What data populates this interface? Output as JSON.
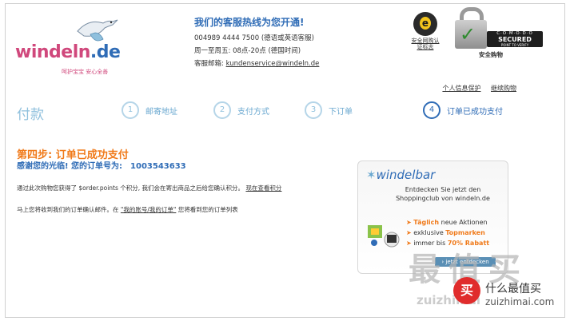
{
  "logo": {
    "wordmark_left": "windeln",
    "wordmark_right": ".de",
    "tagline": "呵护宝宝 安心全善"
  },
  "contact": {
    "title": "我们的客服热线为您开通!",
    "phone": "004989 4444 7500 (德语或英语客服)",
    "hours": "周一至周五: 08点-20点 (德国时间)",
    "email_label": "客服邮箱:",
    "email": "kundenservice@windeln.de"
  },
  "trust": {
    "badge1_label": "安全网购认证标志",
    "comodo_line1": "C·O·M·O·D·O",
    "comodo_line2": "SECURED",
    "comodo_line3": "POINT TO VERIFY",
    "badge2_label": "安全购物"
  },
  "toplinks": {
    "privacy": "个人信息保护",
    "continue": "继续购物"
  },
  "steps": {
    "title": "付款",
    "items": [
      {
        "num": "1",
        "label": "邮寄地址"
      },
      {
        "num": "2",
        "label": "支付方式"
      },
      {
        "num": "3",
        "label": "下订单"
      },
      {
        "num": "4",
        "label": "订单已成功支付"
      }
    ]
  },
  "confirmation": {
    "title": "第四步: 订单已成功支付",
    "thanks": "感谢您的光临! 您的订单号为:",
    "order_number": "1003543633",
    "points_text": "通过此次购物您获得了 $order.points 个积分, 我们会在寄出商品之后给您确认积分。",
    "points_link": "现在查看积分",
    "mail_text_prefix": "马上您将收到我们的订单确认邮件。在",
    "mail_link": "\"我的账号/我的订单\"",
    "mail_text_suffix": "您将看到您的订单列表"
  },
  "banner": {
    "logo": "windelbar",
    "line1": "Entdecken Sie jetzt den",
    "line2": "Shoppingclub von windeln.de",
    "b1_bold": "Täglich",
    "b1_rest": " neue Aktionen",
    "b2_rest": "exklusive ",
    "b2_bold": "Topmarken",
    "b3_rest": "immer bis ",
    "b3_bold": "70% Rabatt",
    "cta": "› jetzt entdecken"
  },
  "watermark": {
    "chars": "最值买",
    "badge": "买",
    "url": "zuizhimai",
    "name": "什么最值买",
    "site": "zuizhimai.com"
  },
  "colors": {
    "brand_pink": "#d0487c",
    "brand_blue": "#2f6cb6",
    "accent_orange": "#f07a1a",
    "step_inactive": "#8fc0dd"
  }
}
